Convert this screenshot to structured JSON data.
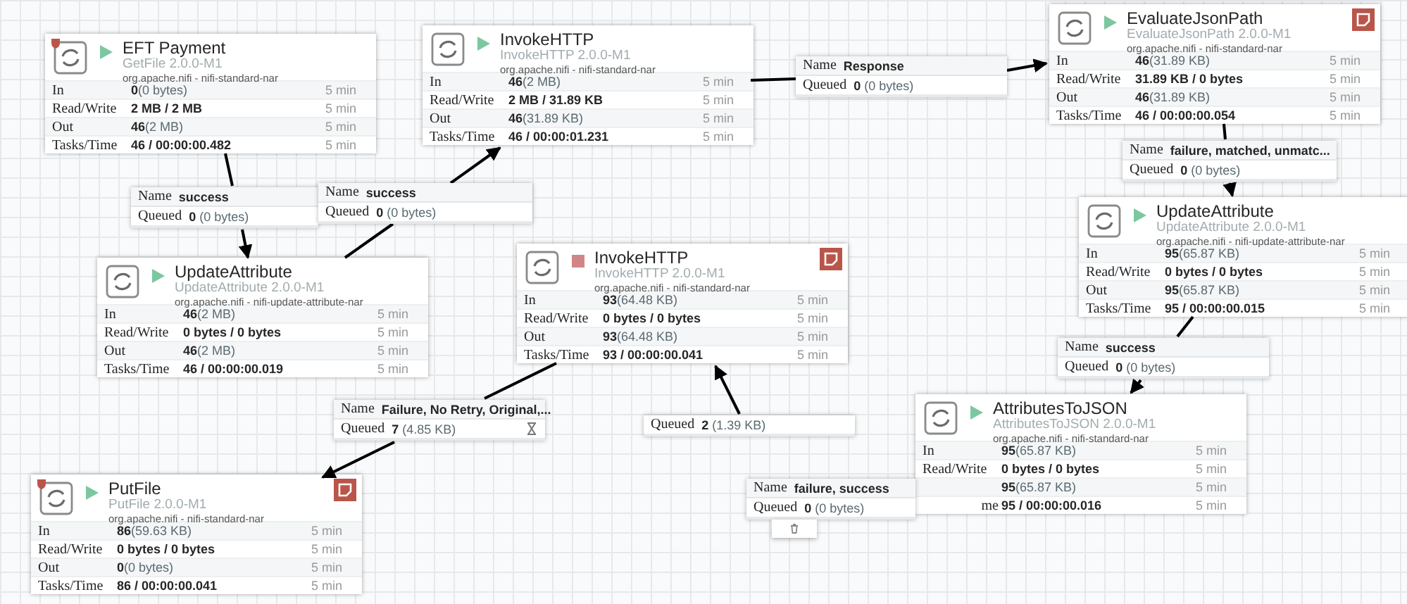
{
  "processors": [
    {
      "name": "EFT Payment",
      "type": "GetFile 2.0.0-M1",
      "bundle": "org.apache.nifi - nifi-standard-nar",
      "running": true,
      "warning": true,
      "note": false,
      "stats": [
        {
          "label": "In",
          "value": "0",
          "detail": "(0 bytes)",
          "period": "5 min"
        },
        {
          "label": "Read/Write",
          "value": "2 MB / 2 MB",
          "period": "5 min"
        },
        {
          "label": "Out",
          "value": "46",
          "detail": "(2 MB)",
          "period": "5 min"
        },
        {
          "label": "Tasks/Time",
          "value": "46 / 00:00:00.482",
          "period": "5 min"
        }
      ]
    },
    {
      "name": "InvokeHTTP",
      "type": "InvokeHTTP 2.0.0-M1",
      "bundle": "org.apache.nifi - nifi-standard-nar",
      "running": true,
      "warning": false,
      "note": false,
      "stats": [
        {
          "label": "In",
          "value": "46",
          "detail": "(2 MB)",
          "period": "5 min"
        },
        {
          "label": "Read/Write",
          "value": "2 MB / 31.89 KB",
          "period": "5 min"
        },
        {
          "label": "Out",
          "value": "46",
          "detail": "(31.89 KB)",
          "period": "5 min"
        },
        {
          "label": "Tasks/Time",
          "value": "46 / 00:00:01.231",
          "period": "5 min"
        }
      ]
    },
    {
      "name": "EvaluateJsonPath",
      "type": "EvaluateJsonPath 2.0.0-M1",
      "bundle": "org.apache.nifi - nifi-standard-nar",
      "running": true,
      "warning": false,
      "note": true,
      "stats": [
        {
          "label": "In",
          "value": "46",
          "detail": "(31.89 KB)",
          "period": "5 min"
        },
        {
          "label": "Read/Write",
          "value": "31.89 KB / 0 bytes",
          "period": "5 min"
        },
        {
          "label": "Out",
          "value": "46",
          "detail": "(31.89 KB)",
          "period": "5 min"
        },
        {
          "label": "Tasks/Time",
          "value": "46 / 00:00:00.054",
          "period": "5 min"
        }
      ]
    },
    {
      "name": "UpdateAttribute",
      "type": "UpdateAttribute 2.0.0-M1",
      "bundle": "org.apache.nifi - nifi-update-attribute-nar",
      "running": true,
      "warning": false,
      "note": false,
      "stats": [
        {
          "label": "In",
          "value": "46",
          "detail": "(2 MB)",
          "period": "5 min"
        },
        {
          "label": "Read/Write",
          "value": "0 bytes / 0 bytes",
          "period": "5 min"
        },
        {
          "label": "Out",
          "value": "46",
          "detail": "(2 MB)",
          "period": "5 min"
        },
        {
          "label": "Tasks/Time",
          "value": "46 / 00:00:00.019",
          "period": "5 min"
        }
      ]
    },
    {
      "name": "InvokeHTTP",
      "type": "InvokeHTTP 2.0.0-M1",
      "bundle": "org.apache.nifi - nifi-standard-nar",
      "running": false,
      "warning": false,
      "note": true,
      "stats": [
        {
          "label": "In",
          "value": "93",
          "detail": "(64.48 KB)",
          "period": "5 min"
        },
        {
          "label": "Read/Write",
          "value": "0 bytes / 0 bytes",
          "period": "5 min"
        },
        {
          "label": "Out",
          "value": "93",
          "detail": "(64.48 KB)",
          "period": "5 min"
        },
        {
          "label": "Tasks/Time",
          "value": "93 / 00:00:00.041",
          "period": "5 min"
        }
      ]
    },
    {
      "name": "UpdateAttribute",
      "type": "UpdateAttribute 2.0.0-M1",
      "bundle": "org.apache.nifi - nifi-update-attribute-nar",
      "running": true,
      "warning": false,
      "note": false,
      "stats": [
        {
          "label": "In",
          "value": "95",
          "detail": "(65.87 KB)",
          "period": "5 min"
        },
        {
          "label": "Read/Write",
          "value": "0 bytes / 0 bytes",
          "period": "5 min"
        },
        {
          "label": "Out",
          "value": "95",
          "detail": "(65.87 KB)",
          "period": "5 min"
        },
        {
          "label": "Tasks/Time",
          "value": "95 / 00:00:00.015",
          "period": "5 min"
        }
      ]
    },
    {
      "name": "AttributesToJSON",
      "type": "AttributesToJSON 2.0.0-M1",
      "bundle": "org.apache.nifi - nifi-standard-nar",
      "running": true,
      "warning": false,
      "note": false,
      "stats": [
        {
          "label": "In",
          "value": "95",
          "detail": "(65.87 KB)",
          "period": "5 min"
        },
        {
          "label": "Read/Write",
          "value": "0 bytes / 0 bytes",
          "period": "5 min"
        },
        {
          "value": "95",
          "detail": "(65.87 KB)",
          "period": "5 min"
        },
        {
          "label": "me",
          "label_clipped": true,
          "value": "95 / 00:00:00.016",
          "period": "5 min"
        }
      ]
    },
    {
      "name": "PutFile",
      "type": "PutFile 2.0.0-M1",
      "bundle": "org.apache.nifi - nifi-standard-nar",
      "running": true,
      "warning": true,
      "note": true,
      "stats": [
        {
          "label": "In",
          "value": "86",
          "detail": "(59.63 KB)",
          "period": "5 min"
        },
        {
          "label": "Read/Write",
          "value": "0 bytes / 0 bytes",
          "period": "5 min"
        },
        {
          "label": "Out",
          "value": "0",
          "detail": "(0 bytes)",
          "period": "5 min"
        },
        {
          "label": "Tasks/Time",
          "value": "86 / 00:00:00.041",
          "period": "5 min"
        }
      ]
    }
  ],
  "connections": [
    {
      "name_label": "Name",
      "name": "success",
      "queued_label": "Queued",
      "queued": "0",
      "queued_size": "(0 bytes)",
      "hourglass": false,
      "tab": false
    },
    {
      "name_label": "Name",
      "name": "success",
      "queued_label": "Queued",
      "queued": "0",
      "queued_size": "(0 bytes)",
      "hourglass": false,
      "tab": false
    },
    {
      "name_label": "Name",
      "name": "Response",
      "queued_label": "Queued",
      "queued": "0",
      "queued_size": "(0 bytes)",
      "hourglass": false,
      "tab": false
    },
    {
      "name_label": "Name",
      "name": "failure, matched, unmatc...",
      "queued_label": "Queued",
      "queued": "0",
      "queued_size": "(0 bytes)",
      "hourglass": false,
      "tab": false
    },
    {
      "name_label": "Name",
      "name": "success",
      "queued_label": "Queued",
      "queued": "0",
      "queued_size": "(0 bytes)",
      "hourglass": false,
      "tab": false
    },
    {
      "name_label": "Name",
      "name": "Failure, No Retry, Original,...",
      "queued_label": "Queued",
      "queued": "7",
      "queued_size": "(4.85 KB)",
      "hourglass": true,
      "tab": false
    },
    {
      "queued_label": "Queued",
      "queued": "2",
      "queued_size": "(1.39 KB)",
      "hourglass": false,
      "tab": false
    },
    {
      "name_label": "Name",
      "name": "failure, success",
      "queued_label": "Queued",
      "queued": "0",
      "queued_size": "(0 bytes)",
      "hourglass": false,
      "tab": true
    }
  ]
}
